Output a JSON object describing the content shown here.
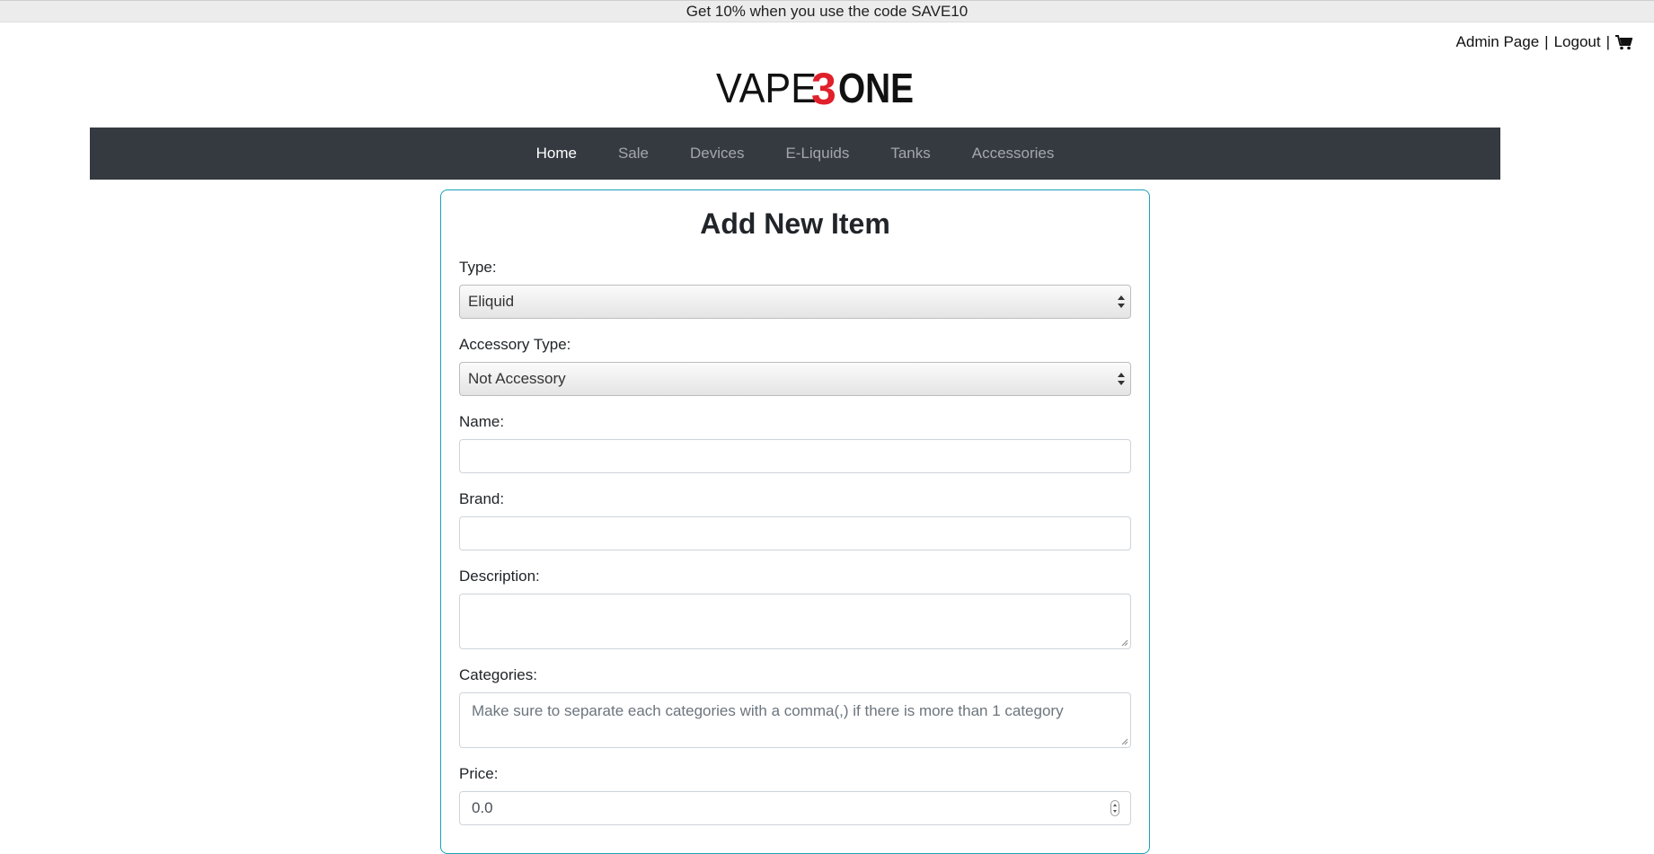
{
  "promo": {
    "text": "Get 10% when you use the code SAVE10"
  },
  "top_links": {
    "admin": "Admin Page",
    "sep1": "|",
    "logout": "Logout",
    "sep2": "|",
    "cart_icon": "shopping-cart-icon"
  },
  "logo": {
    "part1": "VAPE",
    "part2": "3",
    "part3": "ONE",
    "accent_color": "#e0202a"
  },
  "nav": {
    "items": [
      {
        "label": "Home",
        "active": true
      },
      {
        "label": "Sale"
      },
      {
        "label": "Devices"
      },
      {
        "label": "E-Liquids"
      },
      {
        "label": "Tanks"
      },
      {
        "label": "Accessories"
      }
    ]
  },
  "form": {
    "title": "Add New Item",
    "type": {
      "label": "Type:",
      "value": "Eliquid"
    },
    "accessory_type": {
      "label": "Accessory Type:",
      "value": "Not Accessory"
    },
    "name": {
      "label": "Name:",
      "value": ""
    },
    "brand": {
      "label": "Brand:",
      "value": ""
    },
    "description": {
      "label": "Description:",
      "value": ""
    },
    "categories": {
      "label": "Categories:",
      "placeholder": "Make sure to separate each categories with a comma(,) if there is more than 1 category"
    },
    "price": {
      "label": "Price:",
      "value": "0.0"
    }
  },
  "colors": {
    "navbar": "#343a40",
    "card_border": "#17a2b8"
  }
}
